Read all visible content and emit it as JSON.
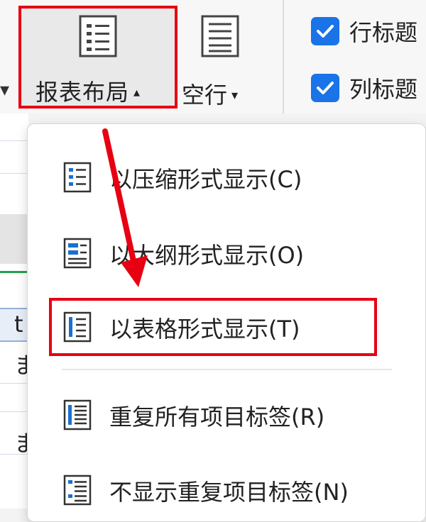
{
  "ribbon": {
    "report_layout": {
      "label": "报表布局",
      "caret": "▴"
    },
    "blank_rows": {
      "label": "空行",
      "caret": "▾"
    },
    "row_headers": {
      "label": "行标题",
      "checked": true
    },
    "column_headers": {
      "label": "列标题",
      "checked": true
    },
    "prev_caret": "▾"
  },
  "menu": {
    "items": [
      {
        "label": "以压缩形式显示(C)",
        "icon": "compact-form-icon"
      },
      {
        "label": "以大纲形式显示(O)",
        "icon": "outline-form-icon"
      },
      {
        "label": "以表格形式显示(T)",
        "icon": "tabular-form-icon",
        "highlighted": true
      },
      {
        "label": "重复所有项目标签(R)",
        "icon": "repeat-labels-icon"
      },
      {
        "label": "不显示重复项目标签(N)",
        "icon": "no-repeat-labels-icon"
      }
    ]
  },
  "sheet": {
    "partial_chars": [
      "t",
      "ま",
      "ま"
    ]
  },
  "colors": {
    "highlight": "#e60012",
    "checkbox": "#1a73e8",
    "icon_blue": "#1a6fd0",
    "arrow": "#e60012"
  }
}
